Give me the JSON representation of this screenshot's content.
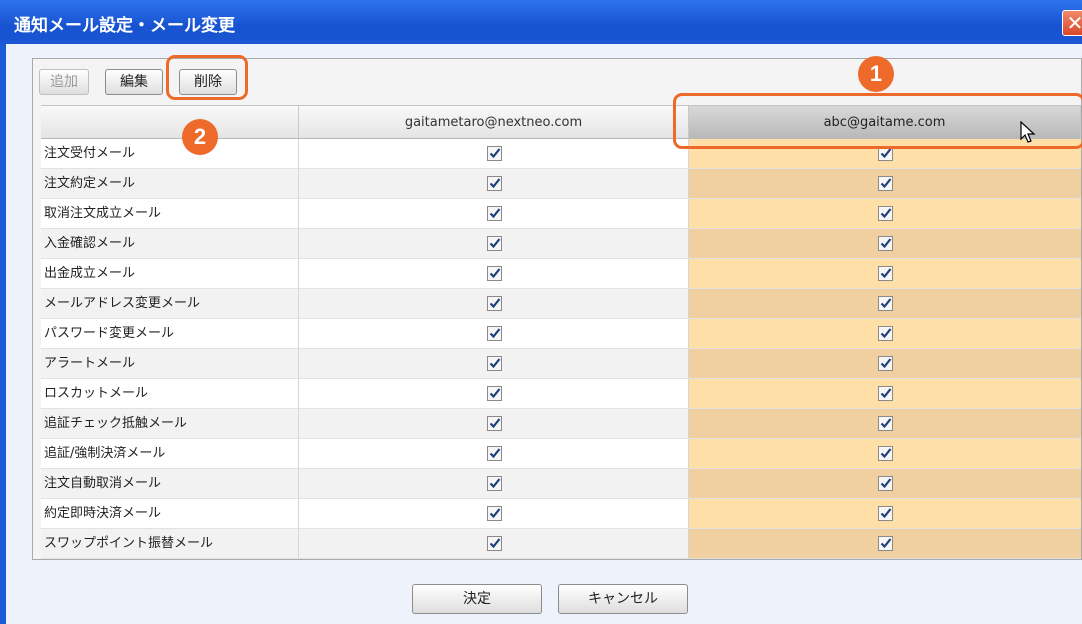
{
  "window": {
    "title": "通知メール設定・メール変更",
    "close_label": "✕"
  },
  "toolbar": {
    "add_label": "追加",
    "edit_label": "編集",
    "delete_label": "削除"
  },
  "grid": {
    "columns": [
      "",
      "gaitametaro@nextneo.com",
      "abc@gaitame.com"
    ],
    "rows": [
      {
        "label": "注文受付メール",
        "col1": true,
        "col2": true
      },
      {
        "label": "注文約定メール",
        "col1": true,
        "col2": true
      },
      {
        "label": "取消注文成立メール",
        "col1": true,
        "col2": true
      },
      {
        "label": "入金確認メール",
        "col1": true,
        "col2": true
      },
      {
        "label": "出金成立メール",
        "col1": true,
        "col2": true
      },
      {
        "label": "メールアドレス変更メール",
        "col1": true,
        "col2": true
      },
      {
        "label": "パスワード変更メール",
        "col1": true,
        "col2": true
      },
      {
        "label": "アラートメール",
        "col1": true,
        "col2": true
      },
      {
        "label": "ロスカットメール",
        "col1": true,
        "col2": true
      },
      {
        "label": "追証チェック抵触メール",
        "col1": true,
        "col2": true
      },
      {
        "label": "追証/強制決済メール",
        "col1": true,
        "col2": true
      },
      {
        "label": "注文自動取消メール",
        "col1": true,
        "col2": true
      },
      {
        "label": "約定即時決済メール",
        "col1": true,
        "col2": true
      },
      {
        "label": "スワップポイント振替メール",
        "col1": true,
        "col2": true
      }
    ]
  },
  "footer": {
    "ok_label": "決定",
    "cancel_label": "キャンセル"
  },
  "annotations": {
    "badge1": "1",
    "badge2": "2",
    "accent_color": "#ee6a2a"
  },
  "colors": {
    "selected_column": "#ffdfa8",
    "title_bar": "#1a56d4"
  }
}
